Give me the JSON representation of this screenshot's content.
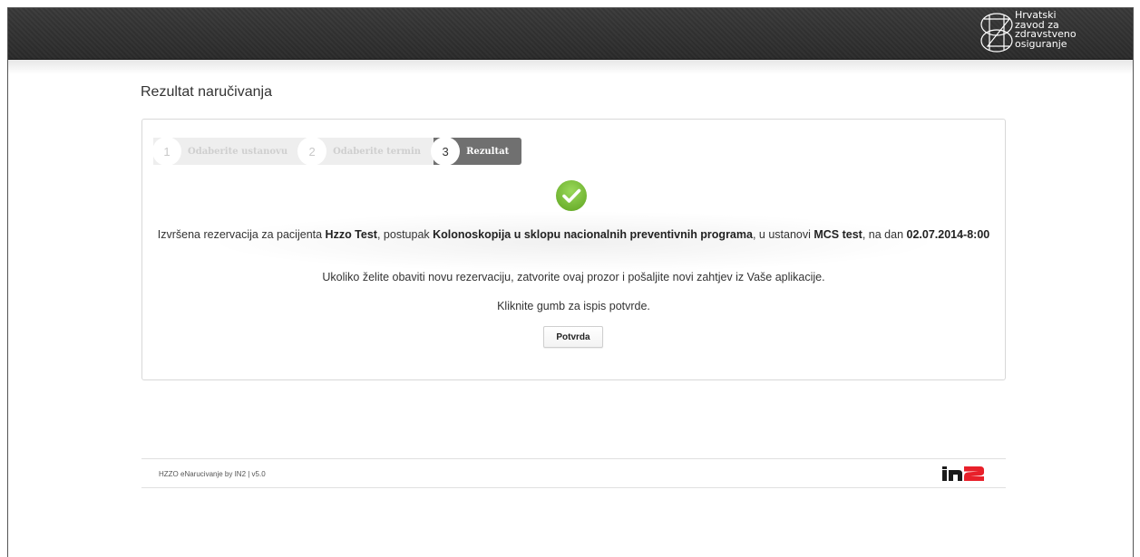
{
  "header": {
    "org_lines": [
      "Hrvatski",
      "zavod za",
      "zdravstveno",
      "osiguranje"
    ]
  },
  "page_title": "Rezultat naručivanja",
  "steps": [
    {
      "num": "1",
      "label": "Odaberite ustanovu",
      "state": "done"
    },
    {
      "num": "2",
      "label": "Odaberite termin",
      "state": "done"
    },
    {
      "num": "3",
      "label": "Rezultat",
      "state": "active"
    }
  ],
  "result": {
    "status_icon": "check-circle-icon",
    "status_color": "#7cbf3a",
    "pre_patient": "Izvršena rezervacija za pacijenta ",
    "patient": "Hzzo Test",
    "pre_procedure": ", postupak ",
    "procedure": "Kolonoskopija u sklopu nacionalnih preventivnih programa",
    "pre_institution": ", u ustanovi ",
    "institution": "MCS test",
    "pre_date": ", na dan ",
    "date": "02.07.2014-8:00",
    "info_new": "Ukoliko želite obaviti novu rezervaciju, zatvorite ovaj prozor i pošaljite novi zahtjev iz Vaše aplikacije.",
    "info_print": "Kliknite gumb za ispis potvrde.",
    "button_label": "Potvrda"
  },
  "footer": {
    "text": "HZZO eNarucivanje by IN2  |  v5.0",
    "brand": "in2"
  }
}
